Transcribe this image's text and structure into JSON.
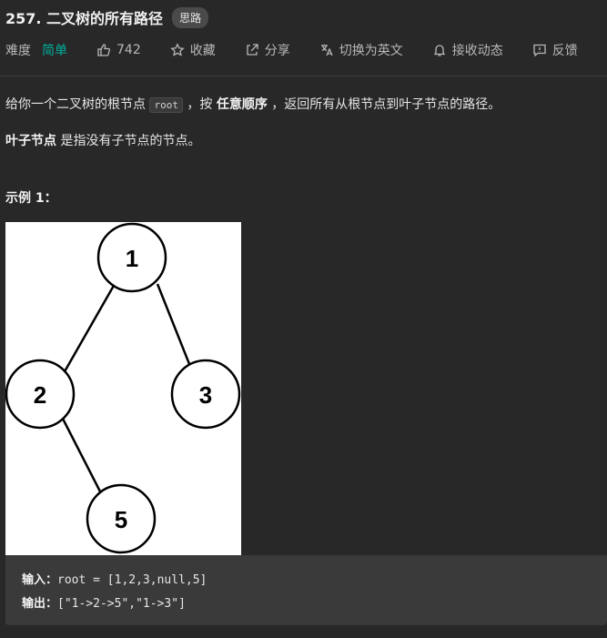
{
  "header": {
    "title": "257. 二叉树的所有路径",
    "badge": "思路"
  },
  "meta": {
    "difficulty_label": "难度",
    "difficulty_value": "简单",
    "likes": "742",
    "favorite": "收藏",
    "share": "分享",
    "translate": "切换为英文",
    "notify": "接收动态",
    "feedback": "反馈"
  },
  "description": {
    "p1_a": "给你一个二叉树的根节点 ",
    "p1_code": "root",
    "p1_b": " ，按 ",
    "p1_bold": "任意顺序",
    "p1_c": " ，返回所有从根节点到叶子节点的路径。",
    "p2_bold": "叶子节点",
    "p2_rest": " 是指没有子节点的节点。"
  },
  "example": {
    "title": "示例 1：",
    "tree_nodes": [
      "1",
      "2",
      "3",
      "5"
    ],
    "input_label": "输入：",
    "input_value": "root = [1,2,3,null,5]",
    "output_label": "输出：",
    "output_value": "[\"1->2->5\",\"1->3\"]"
  },
  "colors": {
    "background": "#282828",
    "easy": "#00af9b"
  }
}
